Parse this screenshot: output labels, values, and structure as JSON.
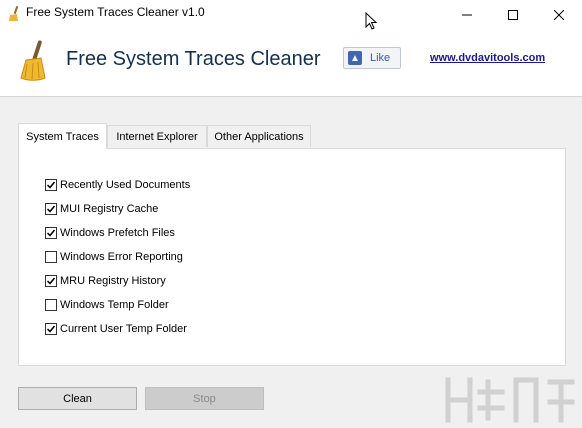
{
  "window": {
    "title": "Free System Traces Cleaner v1.0"
  },
  "header": {
    "app_title": "Free System Traces Cleaner",
    "like_label": "Like",
    "site_link": "www.dvdavitools.com"
  },
  "tabs": [
    {
      "label": "System Traces",
      "active": true
    },
    {
      "label": "Internet Explorer",
      "active": false
    },
    {
      "label": "Other Applications",
      "active": false
    }
  ],
  "items": [
    {
      "label": "Recently Used Documents",
      "checked": true
    },
    {
      "label": "MUI Registry Cache",
      "checked": true
    },
    {
      "label": "Windows Prefetch Files",
      "checked": true
    },
    {
      "label": "Windows Error Reporting",
      "checked": false
    },
    {
      "label": "MRU Registry History",
      "checked": true
    },
    {
      "label": "Windows Temp Folder",
      "checked": false
    },
    {
      "label": "Current User Temp Folder",
      "checked": true
    }
  ],
  "buttons": {
    "clean": "Clean",
    "stop": "Stop"
  },
  "colors": {
    "title_text": "#13314e",
    "link": "#1a1a8a",
    "facebook": "#4267b2"
  },
  "icons": {
    "app": "broom-icon",
    "like": "facebook-thumb-icon"
  }
}
